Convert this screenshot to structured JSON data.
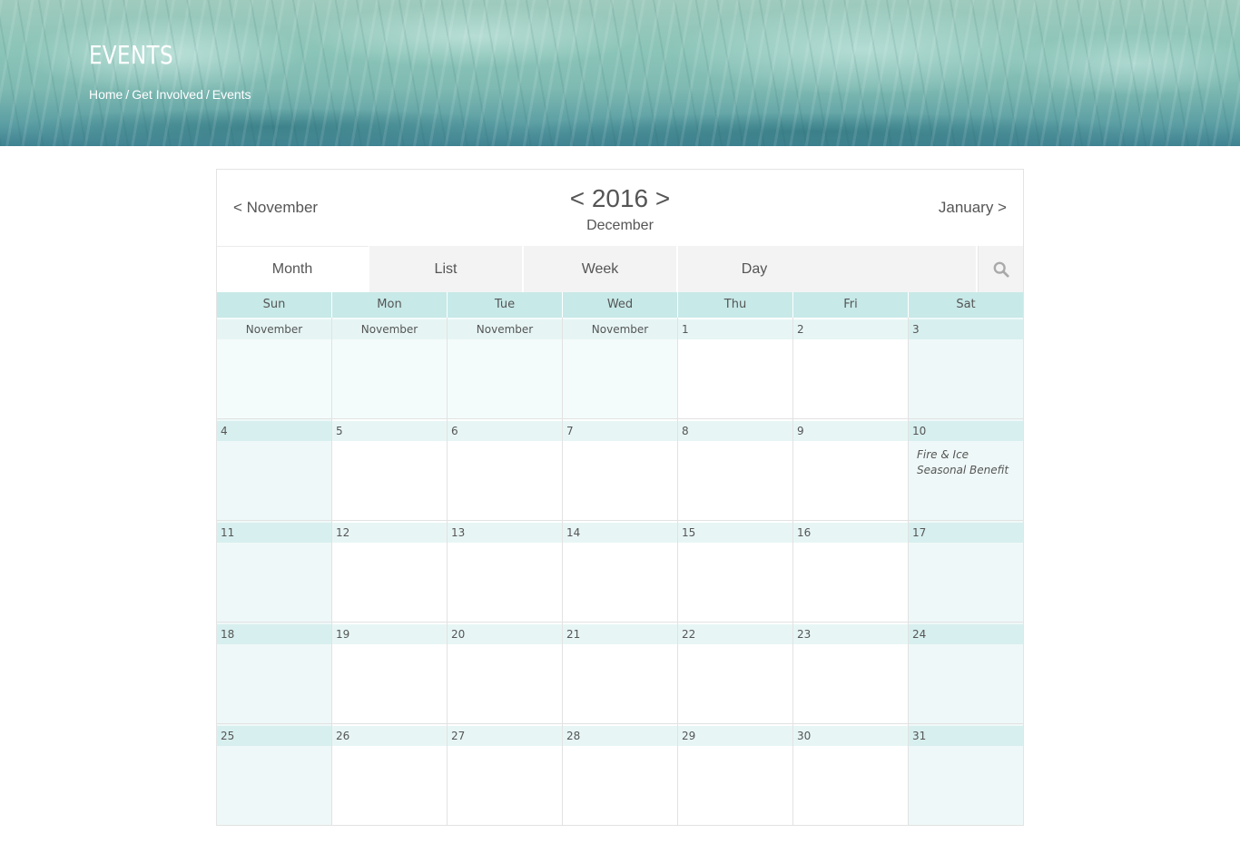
{
  "header": {
    "title": "EVENTS",
    "breadcrumb": [
      "Home",
      "Get Involved",
      "Events"
    ],
    "separator": "/"
  },
  "calendar": {
    "prev_month": "< November",
    "next_month": "January >",
    "year_prev": "<",
    "year": "2016",
    "year_next": ">",
    "month": "December",
    "tabs": [
      "Month",
      "List",
      "Week",
      "Day"
    ],
    "active_tab": "Month",
    "weekdays": [
      "Sun",
      "Mon",
      "Tue",
      "Wed",
      "Thu",
      "Fri",
      "Sat"
    ],
    "weeks": [
      [
        "November",
        "November",
        "November",
        "November",
        "1",
        "2",
        "3"
      ],
      [
        "4",
        "5",
        "6",
        "7",
        "8",
        "9",
        "10"
      ],
      [
        "11",
        "12",
        "13",
        "14",
        "15",
        "16",
        "17"
      ],
      [
        "18",
        "19",
        "20",
        "21",
        "22",
        "23",
        "24"
      ],
      [
        "25",
        "26",
        "27",
        "28",
        "29",
        "30",
        "31"
      ]
    ],
    "event": {
      "day": "10",
      "title": "Fire & Ice Seasonal Benefit"
    }
  },
  "colors": {
    "weekday_header": "#c7e9e8",
    "day_number_bg": "#e7f6f5",
    "weekend_bg": "#eff8f8",
    "text": "#555555"
  }
}
